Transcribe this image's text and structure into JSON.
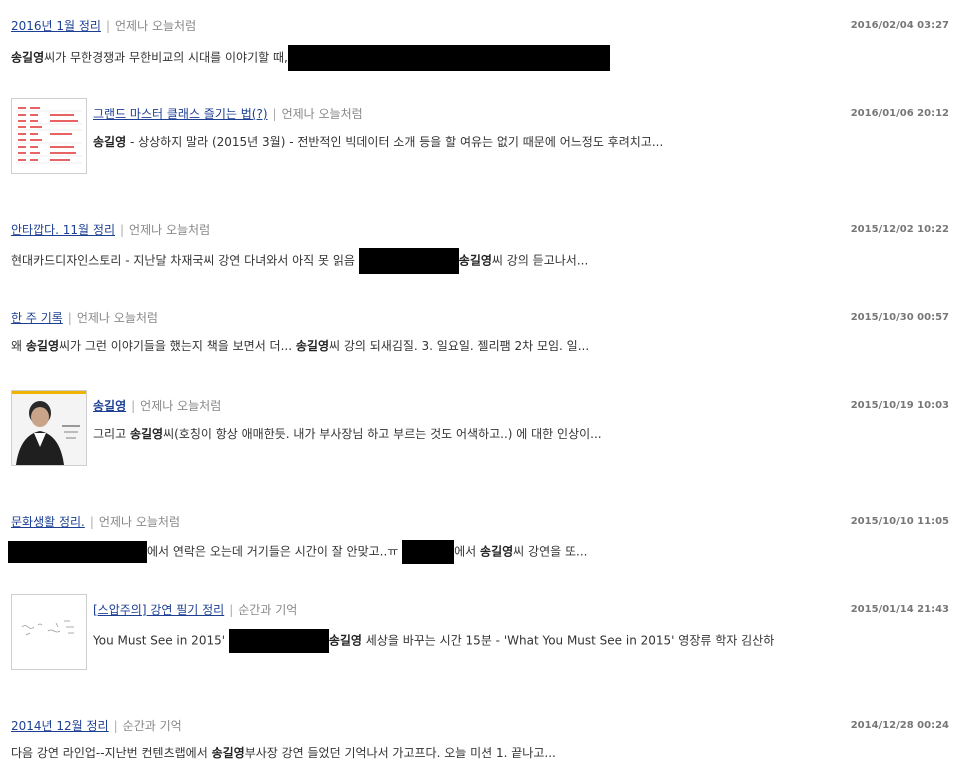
{
  "posts": [
    {
      "title": "2016년 1월 정리",
      "category": "언제나 오늘처럼",
      "date": "2016/02/04 03:27",
      "snippet": {
        "name": "송길영",
        "a": "씨가 무한경쟁과 무한비교의 시대를 이야기할 때,"
      }
    },
    {
      "title": "그랜드 마스터 클래스 즐기는 법(?)",
      "category": "언제나 오늘처럼",
      "date": "2016/01/06 20:12",
      "snippet": {
        "name": "송길영",
        "a": " - 상상하지 말라 (2015년 3월) - 전반적인 빅데이터 소개 등을 할 여유는 없기 때문에 어느정도 후려치고..."
      }
    },
    {
      "title": "안타깝다. 11월 정리",
      "category": "언제나 오늘처럼",
      "date": "2015/12/02 10:22",
      "snippet": {
        "pre": "현대카드디자인스토리 - 지난달 차재국씨 강연 다녀와서 아직 못 읽음 ",
        "name": "송길영",
        "a": "씨 강의 듣고나서..."
      }
    },
    {
      "title": "한 주 기록",
      "category": "언제나 오늘처럼",
      "date": "2015/10/30 00:57",
      "snippet": {
        "pre": "왜 ",
        "name": "송길영",
        "a": "씨가 그런 이야기들을 했는지 책을 보면서 더... ",
        "name2": "송길영",
        "b": "씨 강의 되새김질. 3. 일요일. 젤리팸 2차 모임. 일..."
      }
    },
    {
      "title": "송길영",
      "category": "언제나 오늘처럼",
      "date": "2015/10/19 10:03",
      "snippet": {
        "pre": "그리고 ",
        "name": "송길영",
        "a": "씨(호칭이 항상 애매한듯. 내가 부사장님 하고 부르는 것도 어색하고..) 에 대한 인상이..."
      }
    },
    {
      "title": "문화생활 정리.",
      "category": "언제나 오늘처럼",
      "date": "2015/10/10 11:05",
      "snippet": {
        "a": "에서 연락은 오는데 거기들은 시간이 잘 안맞고..ㅠ ",
        "b": "에서 ",
        "name": "송길영",
        "c": "씨 강연을 또..."
      }
    },
    {
      "title": "[스압주의] 강연 필기 정리",
      "category": "순간과 기억",
      "date": "2015/01/14 21:43",
      "snippet": {
        "pre": "You Must See in 2015' ",
        "name": "송길영",
        "a": " 세상을 바꾸는 시간 15분 - 'What You Must See in 2015' 영장류 학자 김산하"
      }
    },
    {
      "title": "2014년 12월 정리",
      "category": "순간과 기억",
      "date": "2014/12/28 00:24",
      "snippet": {
        "pre": "다음 강연 라인업--지난번 컨텐츠랩에서 ",
        "name": "송길영",
        "a": "부사장 강연 들었던 기억나서 가고프다. 오늘 미션 1. 끝나고..."
      }
    }
  ]
}
